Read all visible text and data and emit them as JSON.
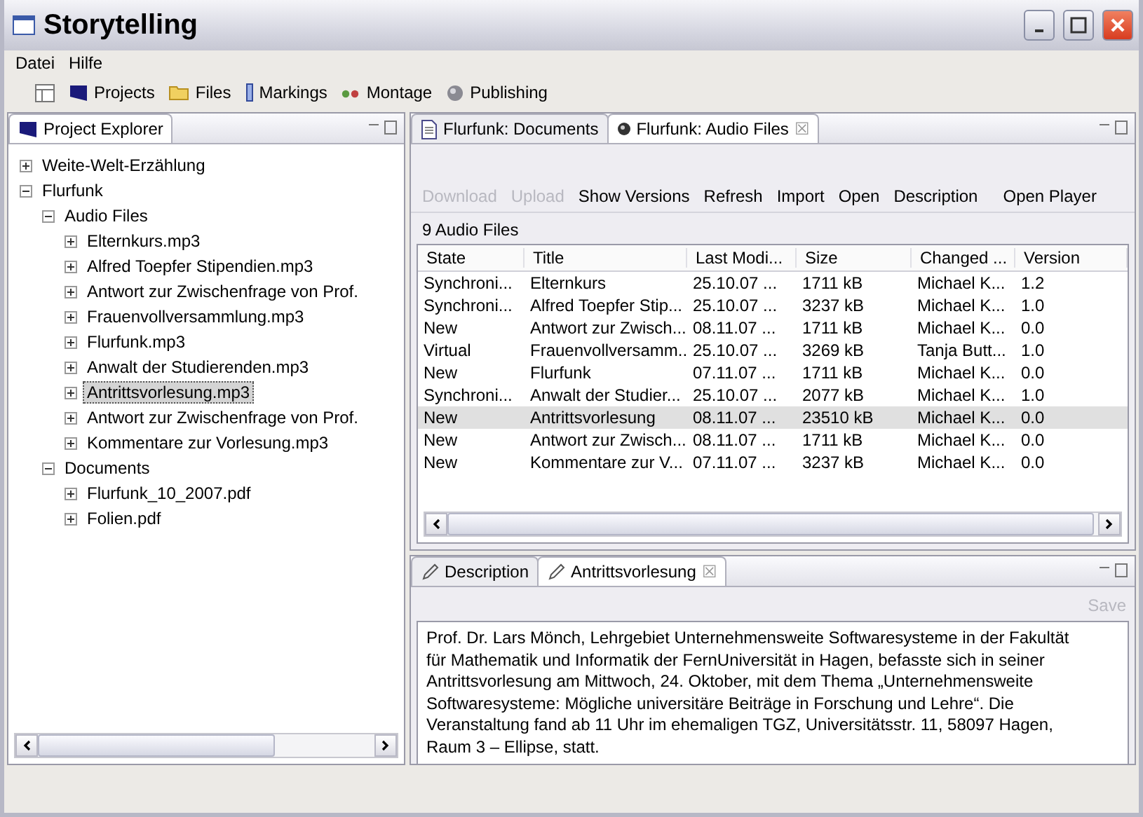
{
  "window": {
    "title": "Storytelling"
  },
  "menu": [
    "Datei",
    "Hilfe"
  ],
  "perspectives": [
    {
      "label": "Projects",
      "kind": "projects"
    },
    {
      "label": "Files",
      "kind": "folder"
    },
    {
      "label": "Markings",
      "kind": "marker"
    },
    {
      "label": "Montage",
      "kind": "montage"
    },
    {
      "label": "Publishing",
      "kind": "globe"
    }
  ],
  "explorer": {
    "title": "Project Explorer",
    "tree": [
      {
        "label": "Weite-Welt-Erzählung",
        "expanded": false,
        "selected": false
      },
      {
        "label": "Flurfunk",
        "expanded": true,
        "selected": false,
        "children": [
          {
            "label": "Audio Files",
            "expanded": true,
            "selected": false,
            "children": [
              {
                "label": "Elternkurs.mp3",
                "expanded": false,
                "selected": false
              },
              {
                "label": "Alfred Toepfer Stipendien.mp3",
                "expanded": false,
                "selected": false
              },
              {
                "label": "Antwort zur Zwischenfrage von Prof.",
                "expanded": false,
                "selected": false
              },
              {
                "label": "Frauenvollversammlung.mp3",
                "expanded": false,
                "selected": false
              },
              {
                "label": "Flurfunk.mp3",
                "expanded": false,
                "selected": false
              },
              {
                "label": "Anwalt der Studierenden.mp3",
                "expanded": false,
                "selected": false
              },
              {
                "label": "Antrittsvorlesung.mp3",
                "expanded": false,
                "selected": true
              },
              {
                "label": "Antwort zur Zwischenfrage von Prof.",
                "expanded": false,
                "selected": false
              },
              {
                "label": "Kommentare zur Vorlesung.mp3",
                "expanded": false,
                "selected": false
              }
            ]
          },
          {
            "label": "Documents",
            "expanded": true,
            "selected": false,
            "children": [
              {
                "label": "Flurfunk_10_2007.pdf",
                "expanded": false,
                "selected": false
              },
              {
                "label": "Folien.pdf",
                "expanded": false,
                "selected": false
              }
            ]
          }
        ]
      }
    ]
  },
  "editor_tabs": [
    {
      "label": "Flurfunk: Documents",
      "kind": "document",
      "selected": false
    },
    {
      "label": "Flurfunk: Audio Files",
      "kind": "audio",
      "selected": true,
      "close": "☒"
    }
  ],
  "actions": [
    {
      "label": "Download",
      "disabled": true
    },
    {
      "label": "Upload",
      "disabled": true
    },
    {
      "label": "Show Versions",
      "disabled": false
    },
    {
      "label": "Refresh",
      "disabled": false
    },
    {
      "label": "Import",
      "disabled": false
    },
    {
      "label": "Open",
      "disabled": false
    },
    {
      "label": "Description",
      "disabled": false
    },
    {
      "label": "Open Player",
      "disabled": false
    }
  ],
  "count": "9 Audio Files",
  "table": {
    "columns": [
      "State",
      "Title",
      "Last Modi...",
      "Size",
      "Changed ...",
      "Version"
    ],
    "rows": [
      {
        "cells": [
          "Synchroni...",
          "Elternkurs",
          "25.10.07 ...",
          "1711 kB",
          "Michael K...",
          "1.2"
        ],
        "selected": false
      },
      {
        "cells": [
          "Synchroni...",
          "Alfred Toepfer Stip...",
          "25.10.07 ...",
          "3237 kB",
          "Michael K...",
          "1.0"
        ],
        "selected": false
      },
      {
        "cells": [
          "New",
          "Antwort zur Zwisch...",
          "08.11.07 ...",
          "1711 kB",
          "Michael K...",
          "0.0"
        ],
        "selected": false
      },
      {
        "cells": [
          "Virtual",
          "Frauenvollversamm...",
          "25.10.07 ...",
          "3269 kB",
          "Tanja Butt...",
          "1.0"
        ],
        "selected": false
      },
      {
        "cells": [
          "New",
          "Flurfunk",
          "07.11.07 ...",
          "1711 kB",
          "Michael K...",
          "0.0"
        ],
        "selected": false
      },
      {
        "cells": [
          "Synchroni...",
          "Anwalt der Studier...",
          "25.10.07 ...",
          "2077 kB",
          "Michael K...",
          "1.0"
        ],
        "selected": false
      },
      {
        "cells": [
          "New",
          "Antrittsvorlesung",
          "08.11.07 ...",
          "23510 kB",
          "Michael K...",
          "0.0"
        ],
        "selected": true
      },
      {
        "cells": [
          "New",
          "Antwort zur Zwisch...",
          "08.11.07 ...",
          "1711 kB",
          "Michael K...",
          "0.0"
        ],
        "selected": false
      },
      {
        "cells": [
          "New",
          "Kommentare zur V...",
          "07.11.07 ...",
          "3237 kB",
          "Michael K...",
          "0.0"
        ],
        "selected": false
      }
    ]
  },
  "description_tabs": [
    {
      "label": "Description",
      "selected": false
    },
    {
      "label": "Antrittsvorlesung",
      "selected": true,
      "close": "☒"
    }
  ],
  "save": {
    "label": "Save",
    "disabled": true
  },
  "description_text": "Prof. Dr. Lars Mönch, Lehrgebiet Unternehmensweite Softwaresysteme in der Fakultät für Mathematik und Informatik der FernUniversität in Hagen, befasste sich in seiner Antrittsvorlesung am Mittwoch, 24. Oktober, mit dem Thema „Unternehmensweite Softwaresysteme: Mögliche universitäre Beiträge in Forschung und Lehre“. Die Veranstaltung fand ab 11 Uhr im ehemaligen TGZ, Universitätsstr. 11, 58097 Hagen, Raum 3 – Ellipse, statt."
}
